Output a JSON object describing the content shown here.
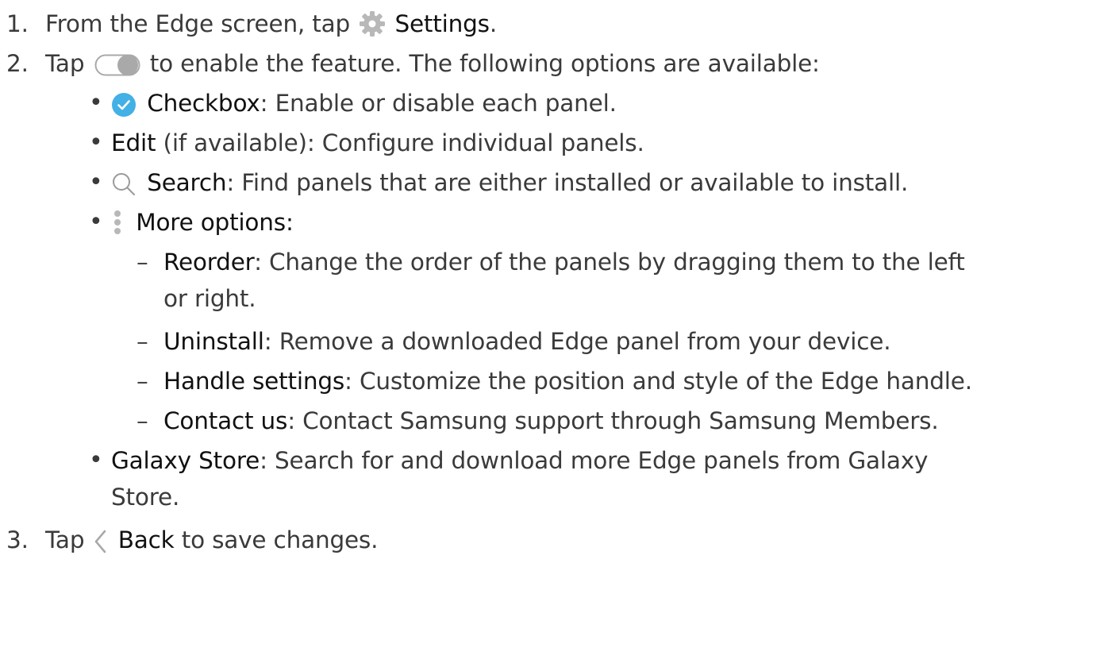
{
  "steps": [
    {
      "number": "1.",
      "prefix": "From the Edge screen, tap",
      "icon": "settings-gear-icon",
      "bold": "Settings",
      "suffix": "."
    },
    {
      "number": "2.",
      "prefix": "Tap",
      "icon": "toggle-switch-icon",
      "suffix": "to enable the feature. The following options are available:"
    },
    {
      "number": "3.",
      "prefix": "Tap",
      "icon": "back-chevron-icon",
      "bold": "Back",
      "suffix": "to save changes."
    }
  ],
  "bullets": [
    {
      "icon": "checkbox-icon",
      "bold": "Checkbox",
      "text": ": Enable or disable each panel."
    },
    {
      "bold": "Edit",
      "text": " (if available): Configure individual panels."
    },
    {
      "icon": "search-icon",
      "bold": "Search",
      "text": ": Find panels that are either installed or available to install."
    },
    {
      "icon": "more-options-icon",
      "bold": "More options",
      "text": ":"
    },
    {
      "bold": "Galaxy Store",
      "text": ": Search for and download more Edge panels from Galaxy",
      "text_line2": "Store."
    }
  ],
  "sub_items": [
    {
      "bold": "Reorder",
      "text": ": Change the order of the panels by dragging them to the left",
      "text_line2": "or right."
    },
    {
      "bold": "Uninstall",
      "text": ": Remove a downloaded Edge panel from your device."
    },
    {
      "bold": "Handle settings",
      "text": ": Customize the position and style of the Edge handle."
    },
    {
      "bold": "Contact us",
      "text": ": Contact Samsung support through Samsung Members."
    }
  ],
  "glyphs": {
    "bullet": "•",
    "dash": "–"
  },
  "colors": {
    "text": "#3a3a3a",
    "bold_text": "#111111",
    "checkbox_blue": "#43b0e6",
    "icon_grey": "#b8b8b8",
    "toggle_grey": "#a9a9a9"
  }
}
